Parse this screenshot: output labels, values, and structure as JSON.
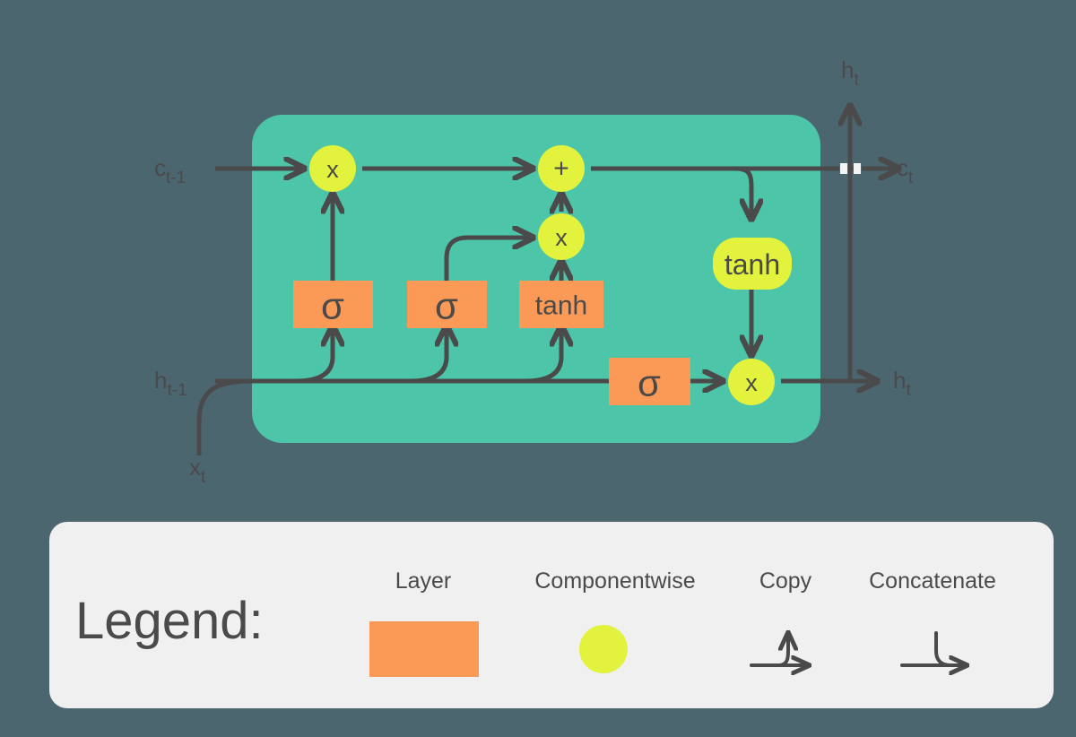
{
  "figure": {
    "name": "LSTM cell diagram",
    "colors": {
      "background": "#4c6670",
      "cell_body": "#4dc5a8",
      "layer_box": "#fb9a57",
      "pointwise_op": "#e3f23c",
      "stroke": "#4a4a4a",
      "legend_panel": "#f0f0f0"
    }
  },
  "cell": {
    "layers": [
      {
        "id": "forget-gate",
        "label": "σ"
      },
      {
        "id": "input-gate",
        "label": "σ"
      },
      {
        "id": "candidate-tanh",
        "label": "tanh"
      },
      {
        "id": "output-gate",
        "label": "σ"
      }
    ],
    "pointwise": [
      {
        "id": "forget-multiply",
        "label": "x"
      },
      {
        "id": "state-add",
        "label": "+"
      },
      {
        "id": "input-multiply",
        "label": "x"
      },
      {
        "id": "output-multiply",
        "label": "x"
      }
    ],
    "activation": {
      "id": "state-tanh",
      "label": "tanh"
    }
  },
  "io": {
    "cell_state_in": {
      "base": "c",
      "sub": "t-1"
    },
    "hidden_in": {
      "base": "h",
      "sub": "t-1"
    },
    "input": {
      "base": "x",
      "sub": "t"
    },
    "cell_state_out": {
      "base": "c",
      "sub": "t"
    },
    "hidden_out_top": {
      "base": "h",
      "sub": "t"
    },
    "hidden_out_right": {
      "base": "h",
      "sub": "t"
    }
  },
  "legend": {
    "title": "Legend:",
    "items": [
      {
        "id": "layer",
        "label": "Layer",
        "glyph": "orange-rectangle-icon"
      },
      {
        "id": "componentwise",
        "label": "Componentwise",
        "glyph": "yellow-circle-icon"
      },
      {
        "id": "copy",
        "label": "Copy",
        "glyph": "copy-arrow-icon"
      },
      {
        "id": "concatenate",
        "label": "Concatenate",
        "glyph": "concatenate-arrow-icon"
      }
    ]
  }
}
